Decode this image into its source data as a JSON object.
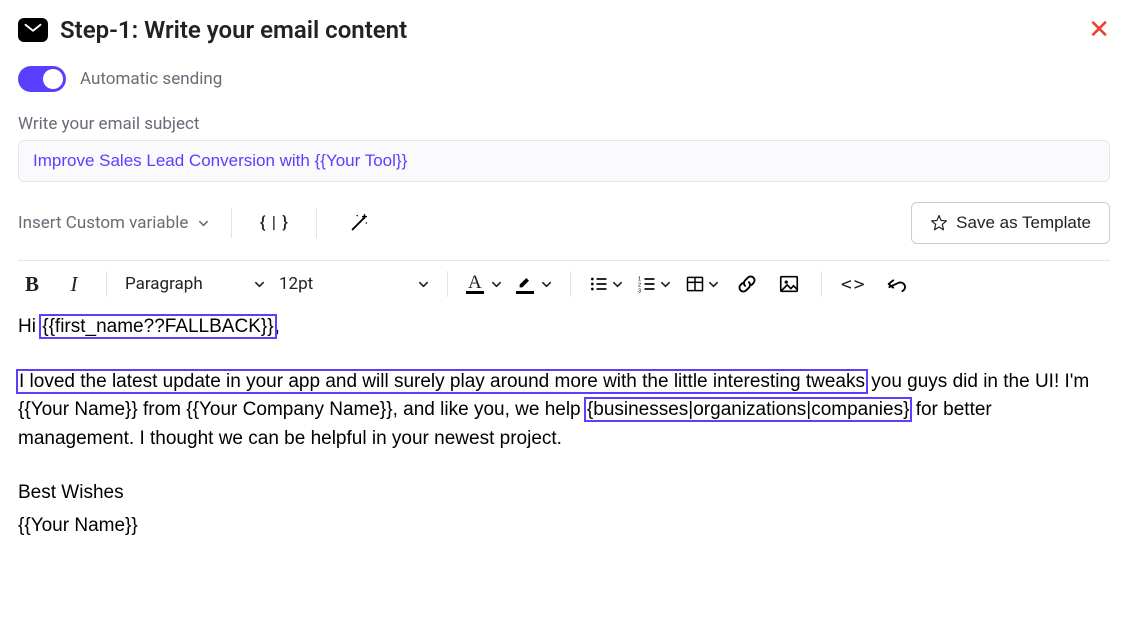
{
  "header": {
    "title": "Step-1:  Write your email content",
    "close": "✕"
  },
  "toggle": {
    "label": "Automatic sending"
  },
  "subject": {
    "label": "Write your email subject",
    "value": "Improve Sales Lead Conversion with {{Your Tool}}"
  },
  "varRow": {
    "insertVar": "Insert Custom variable",
    "bracesLabel": "{ | }",
    "saveTemplate": "Save as Template"
  },
  "toolbar": {
    "bold": "B",
    "italic": "I",
    "paragraph": "Paragraph",
    "fontSize": "12pt",
    "textColorLetter": "A",
    "codeLabel": "<>"
  },
  "body": {
    "l1_a": "Hi ",
    "l1_b": "{{first_name??FALLBACK}}",
    "l1_c": ",",
    "l2_a": "I loved the latest update in your app and will surely play around more with the little interesting tweaks",
    "l2_b": " you guys did in the UI! I'm {{Your Name}} from {{Your Company Name}}, and like you, we help ",
    "l2_c": "{businesses|organizations|companies}",
    "l2_d": " for better management. I thought we can be helpful in your newest project.",
    "l3": "Best Wishes",
    "l4": "{{Your Name}}"
  }
}
